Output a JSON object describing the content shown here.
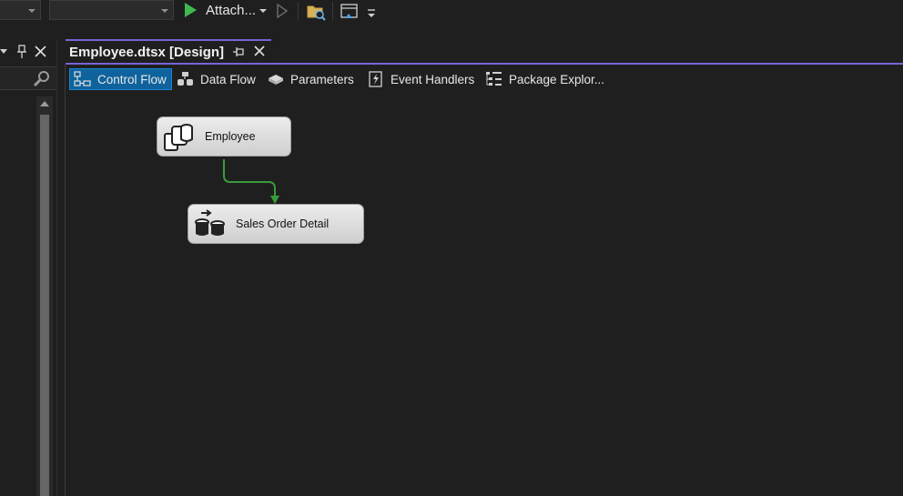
{
  "toolbar": {
    "attach_label": "Attach...",
    "icons": [
      "start-debug-icon",
      "start-without-debugging-icon",
      "open-folder-icon",
      "window-layout-icon",
      "overflow-icon"
    ]
  },
  "document_tab": {
    "title": "Employee.dtsx [Design]"
  },
  "designer_tabs": [
    {
      "label": "Control Flow",
      "icon": "control-flow-icon",
      "active": true
    },
    {
      "label": "Data Flow",
      "icon": "data-flow-icon",
      "active": false
    },
    {
      "label": "Parameters",
      "icon": "parameters-icon",
      "active": false
    },
    {
      "label": "Event Handlers",
      "icon": "event-handlers-icon",
      "active": false
    },
    {
      "label": "Package Explor...",
      "icon": "package-explorer-icon",
      "active": false
    }
  ],
  "tasks": [
    {
      "label": "Employee",
      "icon": "execute-sql-task-icon"
    },
    {
      "label": "Sales Order Detail",
      "icon": "data-flow-task-icon"
    }
  ],
  "colors": {
    "accent": "#7a63d6",
    "active_tab": "#0e639c",
    "connector_success": "#3a9a3a",
    "background": "#1f1f1f"
  }
}
